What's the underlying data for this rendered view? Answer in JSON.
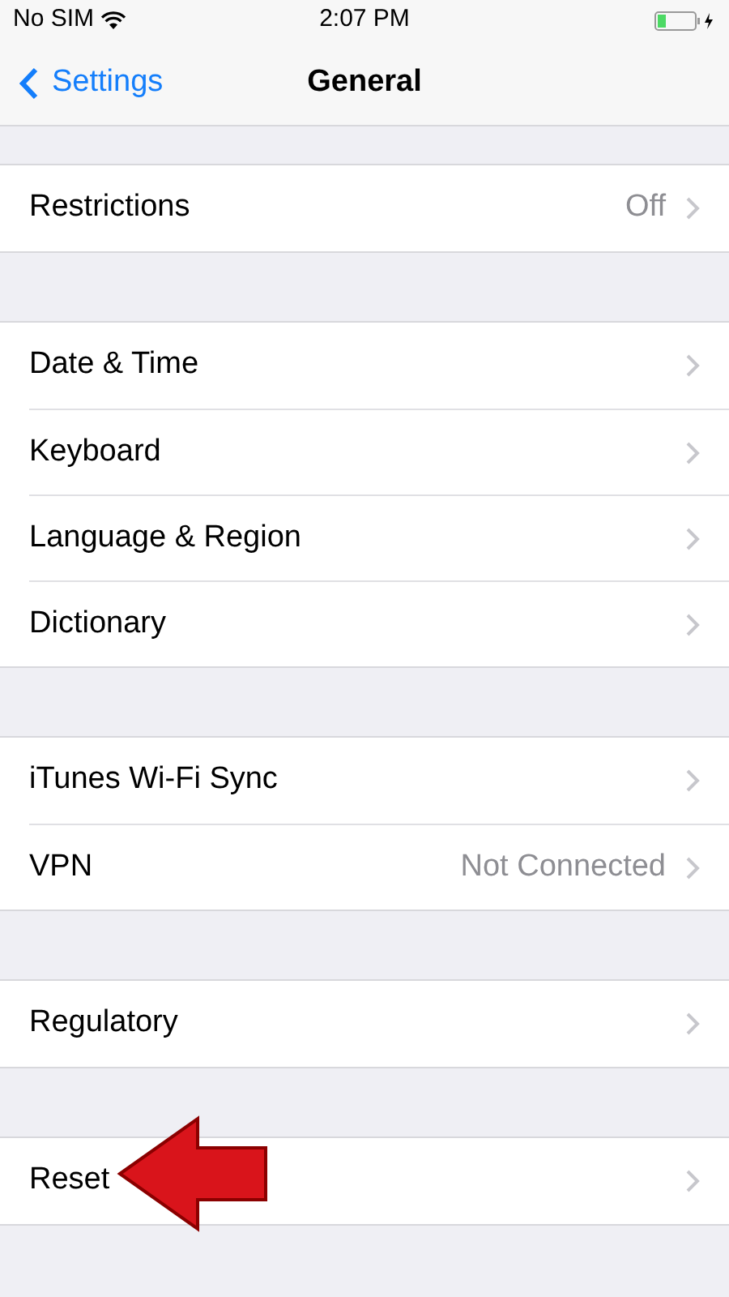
{
  "status_bar": {
    "carrier": "No SIM",
    "time": "2:07 PM"
  },
  "nav_bar": {
    "back": "Settings",
    "title": "General"
  },
  "groups": [
    {
      "rows": [
        {
          "label": "Restrictions",
          "value": "Off"
        }
      ]
    },
    {
      "rows": [
        {
          "label": "Date & Time"
        },
        {
          "label": "Keyboard"
        },
        {
          "label": "Language & Region"
        },
        {
          "label": "Dictionary"
        }
      ]
    },
    {
      "rows": [
        {
          "label": "iTunes Wi-Fi Sync"
        },
        {
          "label": "VPN",
          "value": "Not Connected"
        }
      ]
    },
    {
      "rows": [
        {
          "label": "Regulatory"
        }
      ]
    },
    {
      "rows": [
        {
          "label": "Reset",
          "pointer": true
        }
      ]
    }
  ]
}
